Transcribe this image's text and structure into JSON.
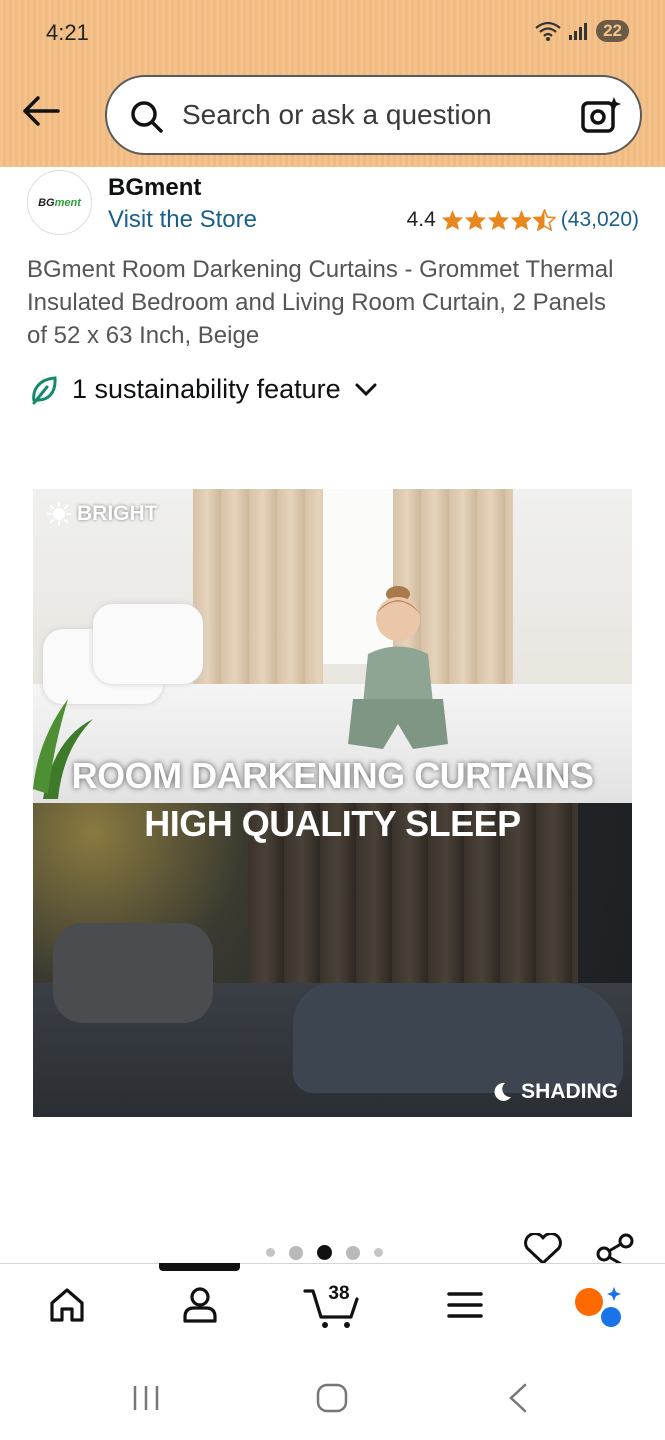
{
  "status_bar": {
    "time": "4:21",
    "battery": "22"
  },
  "search": {
    "placeholder": "Search or ask a question"
  },
  "seller": {
    "logo_text": "BGment",
    "name": "BGment",
    "visit_store": "Visit the Store"
  },
  "rating": {
    "value": "4.4",
    "stars": 4.5,
    "count": "(43,020)"
  },
  "product": {
    "title": "BGment Room Darkening Curtains - Grommet Thermal Insulated Bedroom and Living Room Curtain, 2 Panels of 52 x 63 Inch, Beige",
    "sustainability": "1 sustainability feature"
  },
  "hero_image": {
    "label_top": "BRIGHT",
    "headline_1": "ROOM DARKENING CURTAINS",
    "headline_2": "HIGH QUALITY SLEEP",
    "label_bottom": "SHADING"
  },
  "carousel": {
    "count": 5,
    "active_index": 2
  },
  "bottom_nav": {
    "items": [
      "home-icon",
      "account-icon",
      "cart-icon",
      "menu-icon",
      "rufus-icon"
    ],
    "active": "account",
    "cart_count": "38"
  },
  "colors": {
    "header": "#f4c28a",
    "link": "#1a5f8a",
    "star": "#e8871e",
    "leaf": "#138a6a"
  }
}
